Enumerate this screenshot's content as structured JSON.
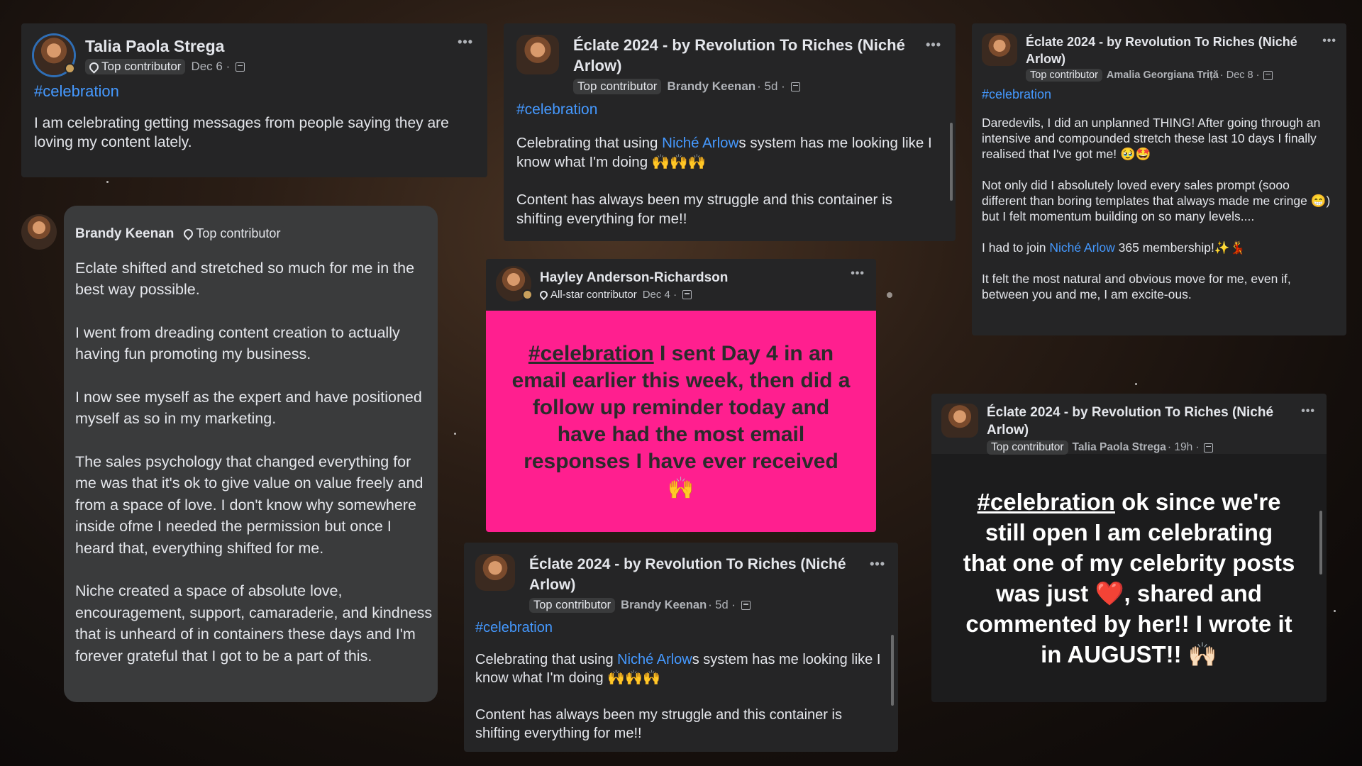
{
  "post1": {
    "author": "Talia Paola Strega",
    "badge": "Top contributor",
    "date": "Dec 6 ·",
    "hashtag": "#celebration",
    "text": "I am celebrating getting messages from people saying they are loving my content lately."
  },
  "post2": {
    "author": "Brandy Keenan",
    "badge": "Top contributor",
    "paragraphs": [
      "Eclate shifted and stretched so much for me in the best way possible.",
      "I went from dreading content creation to actually having fun promoting my business.",
      "I now see myself as the expert and have positioned myself as so in my marketing.",
      "The sales psychology that changed everything for me was that it's ok to give value on value freely and from a space of love.  I don't know why somewhere inside ofme I needed the permission but once I heard that, everything shifted for me.",
      "Niche created a space of absolute love, encouragement, support, camaraderie, and kindness that is unheard of in containers these days and I'm forever grateful that I got to be a part of this."
    ]
  },
  "post3": {
    "group": "Éclate 2024 - by Revolution To Riches (Niché Arlow)",
    "badge": "Top contributor",
    "author": "Brandy Keenan",
    "date": "· 5d ·",
    "hashtag": "#celebration",
    "text_a_pre": "Celebrating that using ",
    "text_a_link": "Niché Arlow",
    "text_a_post": "s system has me looking like I know what I'm doing 🙌🙌🙌",
    "text_b": "Content has always been my struggle and this container is shifting everything for me!!"
  },
  "post4": {
    "author": "Hayley Anderson-Richardson",
    "badge": "All-star contributor",
    "date": "Dec 4 ·",
    "hashtag": "#celebration",
    "text": " I sent Day 4 in an email earlier this week, then did a follow up reminder today and have had the most email responses I have ever received 🙌"
  },
  "post5": {
    "group": "Éclate 2024 - by Revolution To Riches (Niché Arlow)",
    "badge": "Top contributor",
    "author": "Brandy Keenan",
    "date": "· 5d ·",
    "hashtag": "#celebration",
    "text_a_pre": "Celebrating that using ",
    "text_a_link": "Niché Arlow",
    "text_a_post": "s system has me looking like I know what I'm doing 🙌🙌🙌",
    "text_b": "Content has always been my struggle and this container is shifting everything for me!!"
  },
  "post6": {
    "group": "Éclate 2024 - by Revolution To Riches (Niché Arlow)",
    "badge": "Top contributor",
    "author": "Amalia Georgiana Triță",
    "date": "· Dec 8 ·",
    "hashtag": "#celebration",
    "p1": "Daredevils, I did an unplanned THING! After going through an intensive and compounded stretch these last 10 days I finally realised that I've got me! 🥹🤩",
    "p2": "Not only did I absolutely loved every sales prompt (sooo different than boring templates that always made me cringe 😁) but I felt momentum building on so many levels....",
    "p3_pre": "I had to join ",
    "p3_link": "Niché Arlow",
    "p3_post": " 365 membership!✨💃",
    "p4": "It felt the most natural and obvious move for me, even if, between you and me, I am excite-ous."
  },
  "post7": {
    "group": "Éclate 2024 - by Revolution To Riches (Niché Arlow)",
    "badge": "Top contributor",
    "author": "Talia Paola Strega",
    "date": "· 19h ·",
    "hashtag": "#celebration",
    "text": " ok since we're still open I am celebrating that one of my celebrity posts was just ❤️, shared and commented by her!! I wrote it in AUGUST!! 🙌🏻"
  },
  "more_label": "•••",
  "colors": {
    "link": "#4599ff",
    "card": "#252526",
    "pink": "#ff1f8f"
  }
}
